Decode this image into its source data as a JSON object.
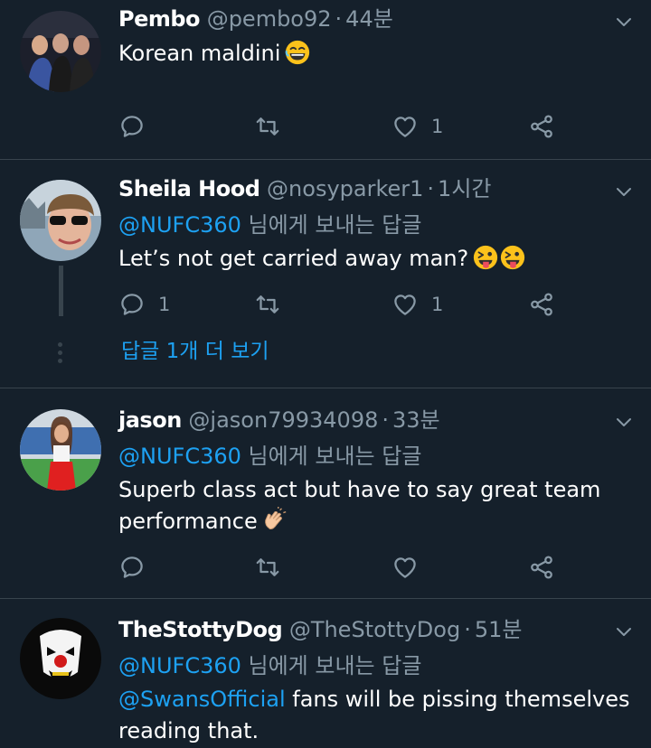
{
  "tweets": [
    {
      "name": "Pembo",
      "handle": "@pembo92",
      "time": "44분",
      "text": "Korean maldini",
      "reply_count": "",
      "like_count": "1"
    },
    {
      "name": "Sheila Hood",
      "handle": "@nosyparker1",
      "time": "1시간",
      "replying_to": "@NUFC360",
      "replying_suffix": " 님에게 보내는 답글",
      "text": "Let’s not get carried away man?",
      "reply_count": "1",
      "like_count": "1",
      "more_replies": "답글 1개 더 보기"
    },
    {
      "name": "jason",
      "handle": "@jason79934098",
      "time": "33분",
      "replying_to": "@NUFC360",
      "replying_suffix": " 님에게 보내는 답글",
      "text_line1": "Superb class act but have to say great team",
      "text_line2": "performance",
      "reply_count": "",
      "like_count": ""
    },
    {
      "name": "TheStottyDog",
      "handle": "@TheStottyDog",
      "time": "51분",
      "replying_to": "@NUFC360",
      "replying_suffix": " 님에게 보내는 답글",
      "text_mention": "@SwansOfficial",
      "text_rest": " fans will be pissing themselves",
      "text_line2": "reading that."
    }
  ],
  "separator": "·",
  "icons": [
    "reply-icon",
    "retweet-icon",
    "like-icon",
    "share-icon",
    "chevron-down-icon"
  ],
  "colors": {
    "background": "#15202b",
    "accent": "#1da1f2",
    "secondary": "#8899a6",
    "border": "#38444d"
  }
}
